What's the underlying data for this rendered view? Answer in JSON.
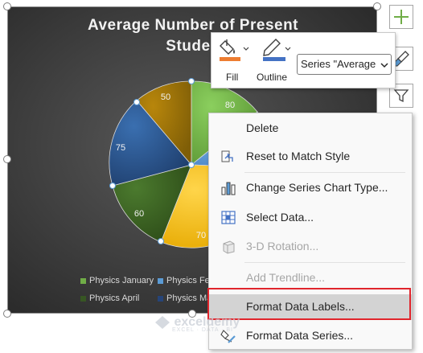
{
  "chart": {
    "title_line1": "Average Number of Present",
    "title_line2": "Studen",
    "data_labels": [
      "80",
      "50",
      "75",
      "60",
      "70"
    ],
    "legend": [
      {
        "label": "Physics January",
        "color": "#70ad47"
      },
      {
        "label": "Physics Feb",
        "color": "#5b9bd5"
      },
      {
        "label": "Physics April",
        "color": "#375623"
      },
      {
        "label": "Physics Ma",
        "color": "#264478"
      }
    ]
  },
  "mini_toolbar": {
    "fill_label": "Fill",
    "outline_label": "Outline",
    "series_select_value": "Series \"Average"
  },
  "context_menu": {
    "items": [
      {
        "label": "Delete",
        "enabled": true
      },
      {
        "label": "Reset to Match Style",
        "enabled": true
      },
      {
        "label": "Change Series Chart Type...",
        "enabled": true
      },
      {
        "label": "Select Data...",
        "enabled": true
      },
      {
        "label": "3-D Rotation...",
        "enabled": false
      },
      {
        "label": "Add Trendline...",
        "enabled": false
      },
      {
        "label": "Format Data Labels...",
        "enabled": true,
        "highlighted": true
      },
      {
        "label": "Format Data Series...",
        "enabled": true
      }
    ]
  },
  "watermark": {
    "name": "exceldemy",
    "tagline": "EXCEL · DATA · BI"
  }
}
